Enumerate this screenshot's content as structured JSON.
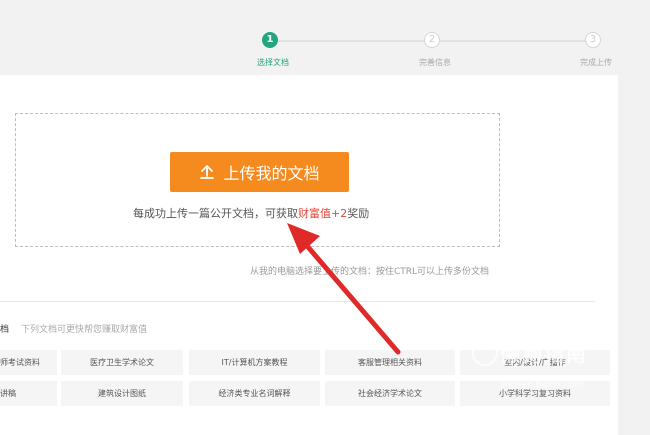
{
  "steps": [
    {
      "num": "1",
      "label": "选择文档",
      "state": "done"
    },
    {
      "num": "2",
      "label": "完善信息",
      "state": "todo"
    },
    {
      "num": "3",
      "label": "完成上传",
      "state": "todo"
    }
  ],
  "upload": {
    "button_label": "上传我的文档",
    "reward_prefix": "每成功上传一篇公开文档，可获取",
    "reward_highlight": "财富值+2",
    "reward_suffix": "奖励"
  },
  "hint": "从我的电脑选择要上传的文档：按住CTRL可以上传多份文档",
  "section": {
    "title": "档",
    "subtitle": "下列文档可更快帮您赚取财富值"
  },
  "categories": {
    "row1": [
      "师考试资料",
      "医疗卫生学术论文",
      "IT/计算机方案教程",
      "客服管理相关资料",
      "室内/设计/广播作"
    ],
    "row2": [
      "讲稿",
      "建筑设计图纸",
      "经济类专业名词解释",
      "社会经济学术论文",
      "小学科学习复习资料"
    ]
  },
  "watermark": {
    "main": "懒狗指南",
    "sub": "jingyan.baidu.com"
  },
  "colors": {
    "accent": "#23a57d",
    "button": "#f58a1f",
    "highlight": "#e0463a",
    "arrow": "#e02a2a"
  }
}
